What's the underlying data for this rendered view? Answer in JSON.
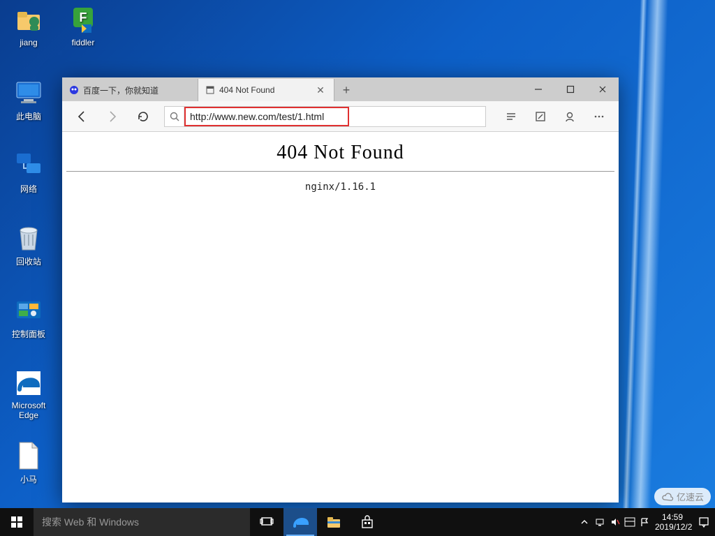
{
  "desktop": {
    "icons": [
      {
        "label": "jiang"
      },
      {
        "label": "fiddler"
      },
      {
        "label": "此电脑"
      },
      {
        "label": "网络"
      },
      {
        "label": "回收站"
      },
      {
        "label": "控制面板"
      },
      {
        "label": "Microsoft Edge"
      },
      {
        "label": "小马"
      }
    ]
  },
  "browser": {
    "tabs": [
      {
        "title": "百度一下，你就知道",
        "active": false
      },
      {
        "title": "404 Not Found",
        "active": true
      }
    ],
    "url": "http://www.new.com/test/1.html",
    "page": {
      "heading": "404 Not Found",
      "server": "nginx/1.16.1"
    },
    "window": {
      "min": "—",
      "max": "▢",
      "close": "✕"
    }
  },
  "taskbar": {
    "search_placeholder": "搜索 Web 和 Windows",
    "time": "14:59",
    "date": "2019/12/2"
  },
  "watermark": "亿速云"
}
